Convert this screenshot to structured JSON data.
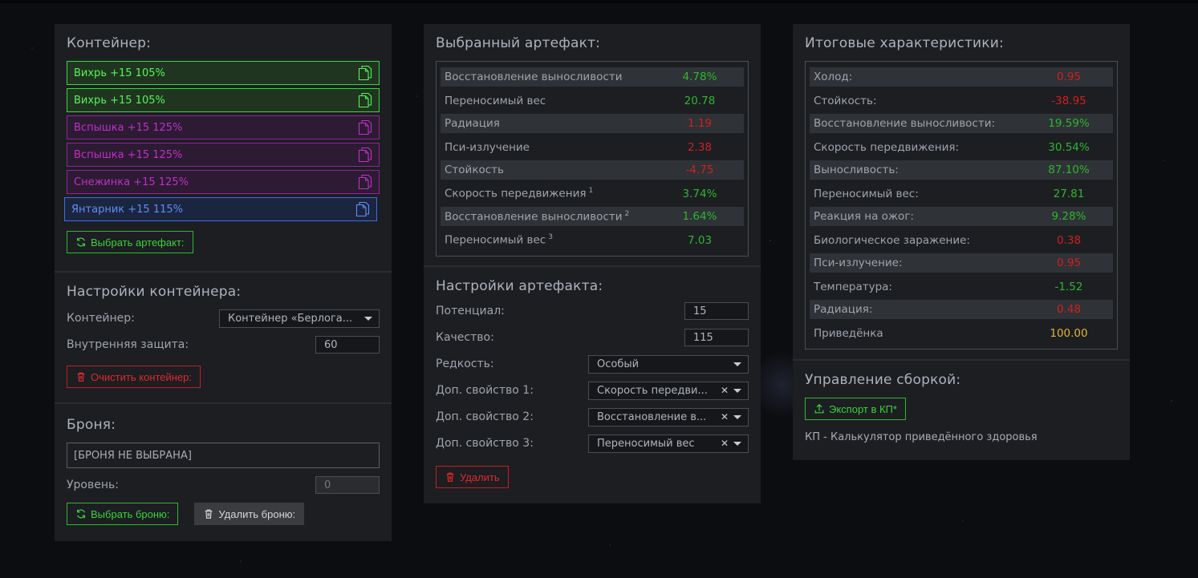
{
  "container": {
    "title": "Контейнер:",
    "slots": [
      {
        "label": "Вихрь +15 105%",
        "color": "#56f456"
      },
      {
        "label": "Вихрь +15 105%",
        "color": "#56f456"
      },
      {
        "label": "Вспышка +15 125%",
        "color": "#c22ec8"
      },
      {
        "label": "Вспышка +15 125%",
        "color": "#c22ec8"
      },
      {
        "label": "Снежинка +15 125%",
        "color": "#c22ec8"
      },
      {
        "label": "Янтарник +15 115%",
        "color": "#5f8ff0"
      }
    ],
    "select_button": "Выбрать артефакт:"
  },
  "container_settings": {
    "title": "Настройки контейнера:",
    "container_label": "Контейнер:",
    "container_value": "Контейнер «Берлога...",
    "protection_label": "Внутренняя защита:",
    "protection_value": "60",
    "clear_button": "Очистить контейнер:"
  },
  "armor": {
    "title": "Броня:",
    "selected": "[БРОНЯ НЕ ВЫБРАНА]",
    "level_label": "Уровень:",
    "level_value": "0",
    "select_button": "Выбрать броню:",
    "delete_button": "Удалить броню:"
  },
  "artifact": {
    "title": "Выбранный артефакт:",
    "stats": [
      {
        "name": "Восстановление выносливости",
        "sup": "",
        "value": "4.78%",
        "tone": "g"
      },
      {
        "name": "Переносимый вес",
        "sup": "",
        "value": "20.78",
        "tone": "g"
      },
      {
        "name": "Радиация",
        "sup": "",
        "value": "1.19",
        "tone": "r"
      },
      {
        "name": "Пси-излучение",
        "sup": "",
        "value": "2.38",
        "tone": "r"
      },
      {
        "name": "Стойкость",
        "sup": "",
        "value": "-4.75",
        "tone": "r"
      },
      {
        "name": "Скорость передвижения",
        "sup": "1",
        "value": "3.74%",
        "tone": "g"
      },
      {
        "name": "Восстановление выносливости",
        "sup": "2",
        "value": "1.64%",
        "tone": "g"
      },
      {
        "name": "Переносимый вес",
        "sup": "3",
        "value": "7.03",
        "tone": "g"
      }
    ]
  },
  "artifact_settings": {
    "title": "Настройки артефакта:",
    "potential_label": "Потенциал:",
    "potential_value": "15",
    "quality_label": "Качество:",
    "quality_value": "115",
    "rarity_label": "Редкость:",
    "rarity_value": "Особый",
    "prop1_label": "Доп. свойство 1:",
    "prop1_value": "Скорость передви...",
    "prop2_label": "Доп. свойство 2:",
    "prop2_value": "Восстановление в...",
    "prop3_label": "Доп. свойство 3:",
    "prop3_value": "Переносимый вес",
    "delete_button": "Удалить"
  },
  "totals": {
    "title": "Итоговые характеристики:",
    "stats": [
      {
        "name": "Холод:",
        "value": "0.95",
        "tone": "r"
      },
      {
        "name": "Стойкость:",
        "value": "-38.95",
        "tone": "r"
      },
      {
        "name": "Восстановление выносливости:",
        "value": "19.59%",
        "tone": "g"
      },
      {
        "name": "Скорость передвижения:",
        "value": "30.54%",
        "tone": "g"
      },
      {
        "name": "Выносливость:",
        "value": "87.10%",
        "tone": "g"
      },
      {
        "name": "Переносимый вес:",
        "value": "27.81",
        "tone": "g"
      },
      {
        "name": "Реакция на ожог:",
        "value": "9.28%",
        "tone": "g"
      },
      {
        "name": "Биологическое заражение:",
        "value": "0.38",
        "tone": "r"
      },
      {
        "name": "Пси-излучение:",
        "value": "0.95",
        "tone": "r"
      },
      {
        "name": "Температура:",
        "value": "-1.52",
        "tone": "g"
      },
      {
        "name": "Радиация:",
        "value": "0.48",
        "tone": "r"
      },
      {
        "name": "Приведёнка",
        "value": "100.00",
        "tone": "y"
      }
    ]
  },
  "build": {
    "title": "Управление сборкой:",
    "export_button": "Экспорт в КП*",
    "note": "КП - Калькулятор приведённого здоровья"
  },
  "icons": [
    "copy-icon",
    "refresh-icon",
    "trash-icon",
    "upload-icon",
    "caret-down-icon",
    "clear-x-icon"
  ]
}
